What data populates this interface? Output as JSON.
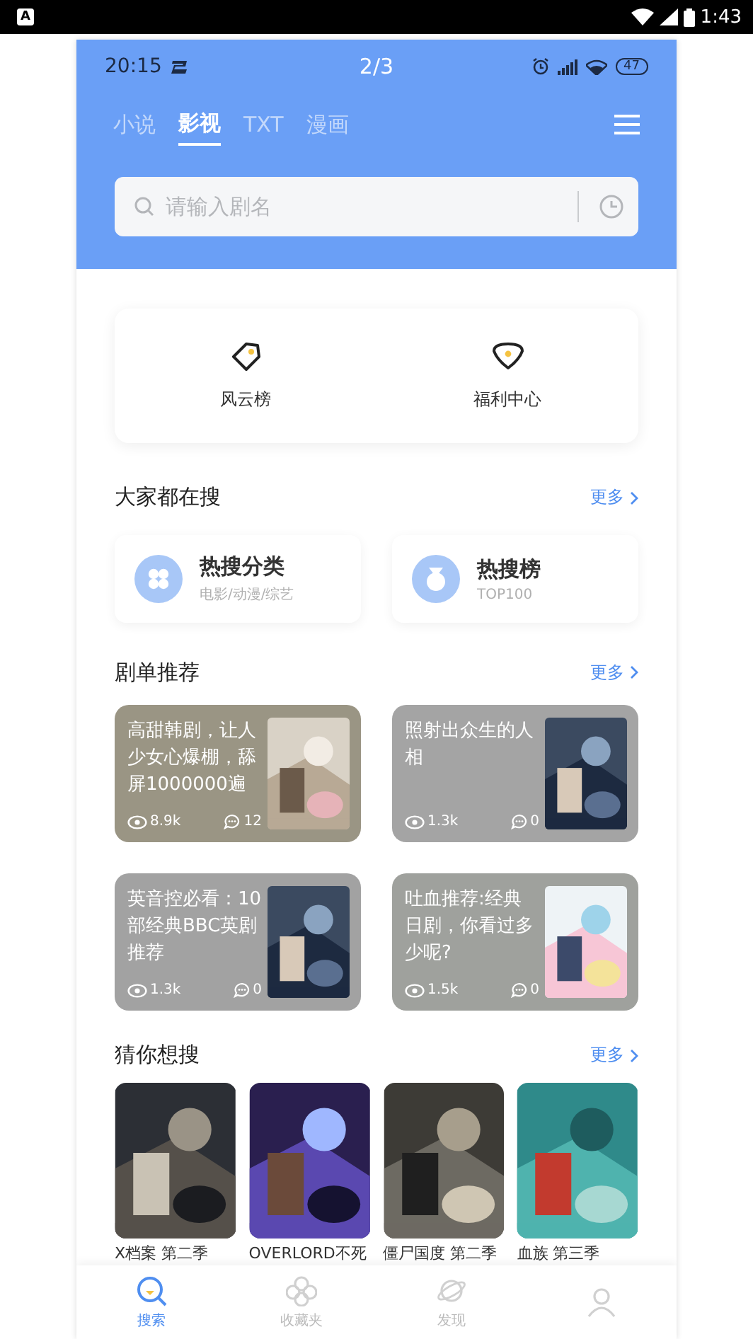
{
  "device_status": {
    "badge": "A",
    "time": "1:43"
  },
  "app_status": {
    "time": "20:15",
    "page": "2/3",
    "battery": "47"
  },
  "tabs": [
    {
      "label": "小说",
      "selected": false
    },
    {
      "label": "影视",
      "selected": true
    },
    {
      "label": "TXT",
      "selected": false
    },
    {
      "label": "漫画",
      "selected": false
    }
  ],
  "search": {
    "placeholder": "请输入剧名"
  },
  "shortcuts": [
    {
      "kind": "tag",
      "label": "风云榜"
    },
    {
      "kind": "heart",
      "label": "福利中心"
    }
  ],
  "hot_section": {
    "title": "大家都在搜",
    "more": "更多"
  },
  "hot_cards": [
    {
      "kind": "grid",
      "title": "热搜分类",
      "subtitle": "电影/动漫/综艺"
    },
    {
      "kind": "medal",
      "title": "热搜榜",
      "subtitle": "TOP100"
    }
  ],
  "recommend_section": {
    "title": "剧单推荐",
    "more": "更多"
  },
  "recommend": [
    {
      "title": "高甜韩剧，让人少女心爆棚，舔屏1000000遍",
      "views": "8.9k",
      "comments": "12",
      "color": "#9a9584"
    },
    {
      "title": "照射出众生的人相",
      "views": "1.3k",
      "comments": "0",
      "color": "#a4a4a4"
    },
    {
      "title": "英音控必看：10部经典BBC英剧推荐",
      "views": "1.3k",
      "comments": "0",
      "color": "#a2a2a2"
    },
    {
      "title": "吐血推荐:经典日剧，你看过多少呢?",
      "views": "1.5k",
      "comments": "0",
      "color": "#9fa19d"
    }
  ],
  "guess_section": {
    "title": "猜你想搜",
    "more": "更多"
  },
  "guess": [
    {
      "title": "X档案 第二季"
    },
    {
      "title": "OVERLORD不死"
    },
    {
      "title": "僵尸国度 第二季"
    },
    {
      "title": "血族 第三季"
    }
  ],
  "bottom_nav": [
    {
      "kind": "search",
      "label": "搜索",
      "selected": true
    },
    {
      "kind": "flower",
      "label": "收藏夹",
      "selected": false
    },
    {
      "kind": "planet",
      "label": "发现",
      "selected": false
    },
    {
      "kind": "person",
      "selected": false
    }
  ]
}
